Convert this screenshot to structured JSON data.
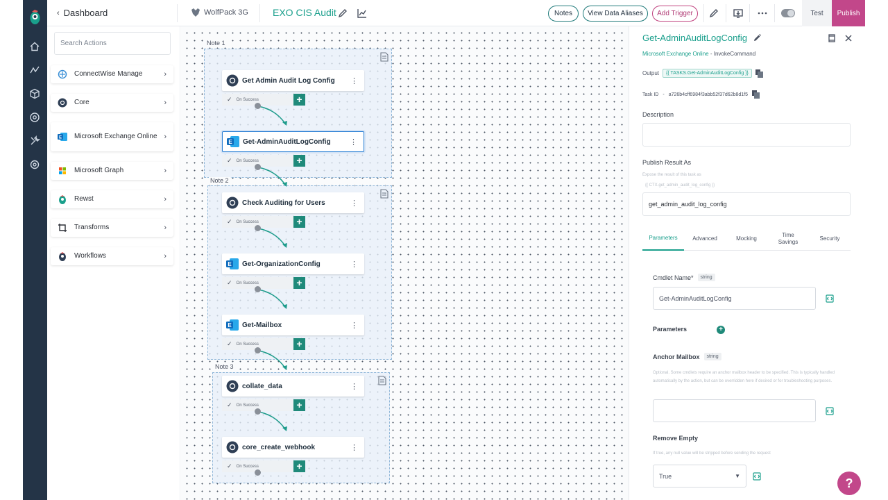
{
  "topbar": {
    "back_label": "Dashboard",
    "org_name": "WolfPack 3G",
    "workflow_title": "EXO CIS Audit",
    "notes_label": "Notes",
    "view_aliases_label": "View Data Aliases",
    "add_trigger_label": "Add Trigger",
    "test_label": "Test",
    "publish_label": "Publish"
  },
  "sidebar": {
    "search_placeholder": "Search Actions",
    "categories": [
      {
        "label": "ConnectWise Manage",
        "icon": "connectwise-icon"
      },
      {
        "label": "Core",
        "icon": "core-icon"
      },
      {
        "label": "Microsoft Exchange Online",
        "icon": "exchange-icon"
      },
      {
        "label": "Microsoft Graph",
        "icon": "graph-icon"
      },
      {
        "label": "Rewst",
        "icon": "rewst-icon"
      },
      {
        "label": "Transforms",
        "icon": "crop-icon"
      },
      {
        "label": "Workflows",
        "icon": "workflow-icon"
      }
    ]
  },
  "canvas": {
    "notes": [
      "Note 1",
      "Note 2",
      "Note 3"
    ],
    "on_success_label": "On Success",
    "nodes": [
      {
        "label": "Get Admin Audit Log Config",
        "icon": "core-icon"
      },
      {
        "label": "Get-AdminAuditLogConfig",
        "icon": "exchange-icon"
      },
      {
        "label": "Check Auditing for Users",
        "icon": "core-icon"
      },
      {
        "label": "Get-OrganizationConfig",
        "icon": "exchange-icon"
      },
      {
        "label": "Get-Mailbox",
        "icon": "exchange-icon"
      },
      {
        "label": "collate_data",
        "icon": "core-icon"
      },
      {
        "label": "core_create_webhook",
        "icon": "core-icon"
      }
    ]
  },
  "panel": {
    "title": "Get-AdminAuditLogConfig",
    "integration": "Microsoft Exchange Online",
    "separator": " - ",
    "action_type": "InvokeCommand",
    "output_label": "Output",
    "output_value": "{{ TASKS.Get-AdminAuditLogConfig }}",
    "task_id_label": "Task ID",
    "task_id_value": "a726b4cff6984f3abb52f37d62b8d1f5",
    "description_label": "Description",
    "publish_label": "Publish Result As",
    "publish_hint": "Expose the result of this task as",
    "publish_hint_value": "{{ CTX.get_admin_audit_log_config }}",
    "publish_value": "get_admin_audit_log_config",
    "tabs": [
      "Parameters",
      "Advanced",
      "Mocking",
      "Time Savings",
      "Security"
    ],
    "cmdlet_label": "Cmdlet Name*",
    "string_type": "string",
    "cmdlet_value": "Get-AdminAuditLogConfig",
    "parameters_label": "Parameters",
    "anchor_label": "Anchor Mailbox",
    "anchor_hint": "Optional. Some cmdlets require an anchor mailbox header to be specified. This is typically handled automatically by the action, but can be overridden here if desired or for troubleshooting purposes.",
    "remove_empty_label": "Remove Empty",
    "remove_empty_hint": "If true, any null value will be stripped before sending the request",
    "remove_empty_value": "True"
  },
  "help_label": "?"
}
